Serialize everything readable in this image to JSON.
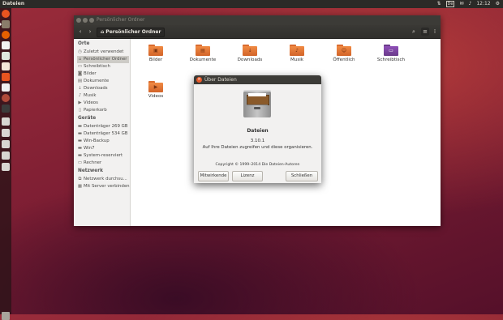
{
  "top_panel": {
    "app_title": "Dateien",
    "keyboard": "De",
    "time": "12:12"
  },
  "window": {
    "title": "Persönlicher Ordner",
    "path_label": "Persönlicher Ordner"
  },
  "sidebar": {
    "section_orte": "Orte",
    "orte": [
      {
        "label": "Zuletzt verwendet",
        "icon": "clock-icon"
      },
      {
        "label": "Persönlicher Ordner",
        "icon": "home-icon"
      },
      {
        "label": "Schreibtisch",
        "icon": "desktop-icon"
      },
      {
        "label": "Bilder",
        "icon": "camera-icon"
      },
      {
        "label": "Dokumente",
        "icon": "document-icon"
      },
      {
        "label": "Downloads",
        "icon": "download-icon"
      },
      {
        "label": "Musik",
        "icon": "music-icon"
      },
      {
        "label": "Videos",
        "icon": "video-icon"
      },
      {
        "label": "Papierkorb",
        "icon": "trash-icon"
      }
    ],
    "section_geraete": "Geräte",
    "geraete": [
      {
        "label": "Datenträger 269 GB",
        "icon": "drive-icon"
      },
      {
        "label": "Datenträger 534 GB",
        "icon": "drive-icon"
      },
      {
        "label": "Win-Backup",
        "icon": "drive-icon"
      },
      {
        "label": "Win7",
        "icon": "drive-icon"
      },
      {
        "label": "System-reserviert",
        "icon": "drive-icon"
      },
      {
        "label": "Rechner",
        "icon": "computer-icon"
      }
    ],
    "section_netzwerk": "Netzwerk",
    "netzwerk": [
      {
        "label": "Netzwerk durchsu...",
        "icon": "network-icon"
      },
      {
        "label": "Mit Server verbinden",
        "icon": "server-icon"
      }
    ]
  },
  "folders": [
    {
      "label": "Bilder",
      "icon": "pictures-folder-icon"
    },
    {
      "label": "Dokumente",
      "icon": "documents-folder-icon"
    },
    {
      "label": "Downloads",
      "icon": "downloads-folder-icon"
    },
    {
      "label": "Musik",
      "icon": "music-folder-icon"
    },
    {
      "label": "Öffentlich",
      "icon": "public-folder-icon"
    },
    {
      "label": "Schreibtisch",
      "icon": "desktop-folder-icon"
    },
    {
      "label": "Videos",
      "icon": "videos-folder-icon"
    }
  ],
  "dialog": {
    "title": "Über Dateien",
    "app_name": "Dateien",
    "version": "3.10.1",
    "description": "Auf Ihre Dateien zugreifen und diese organisieren.",
    "copyright": "Copyright © 1999–2014 Die Dateien-Autoren",
    "btn_credits": "Mitwirkende",
    "btn_license": "Lizenz",
    "btn_close": "Schließen"
  },
  "colors": {
    "accent": "#e95420",
    "folder": "#f08a43",
    "panel": "#2b2a27"
  }
}
